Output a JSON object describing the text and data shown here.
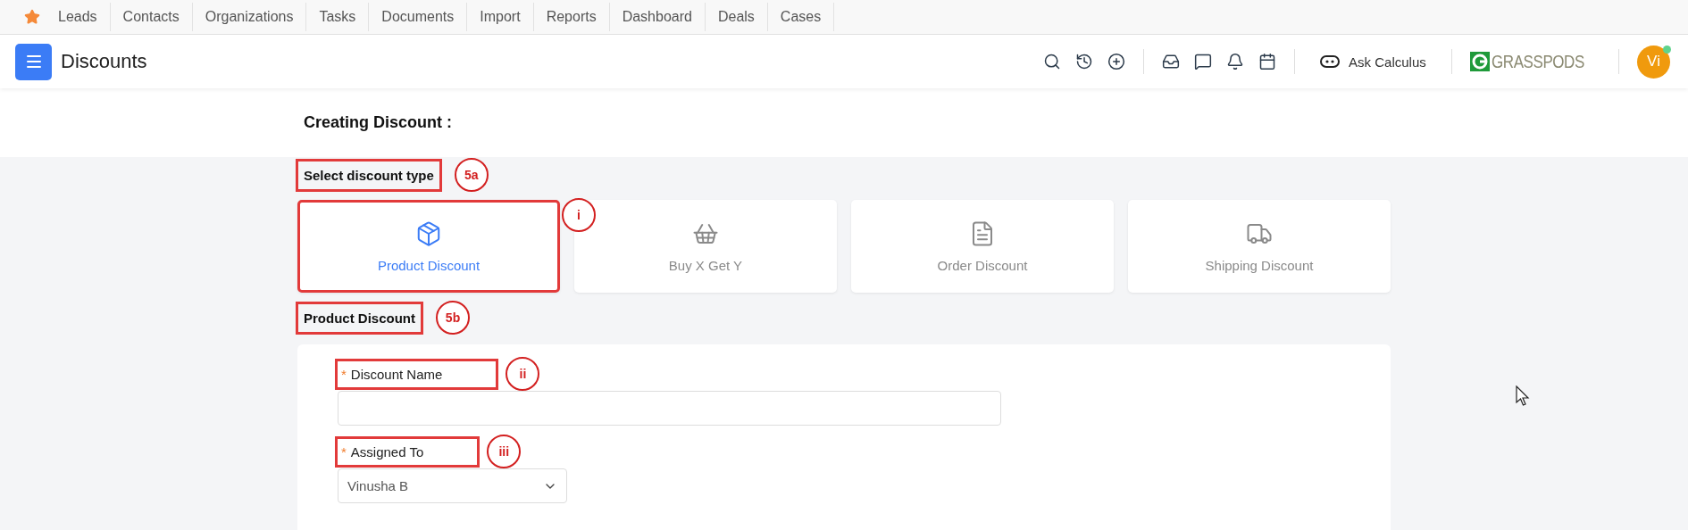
{
  "top_nav": {
    "items": [
      {
        "label": "Leads"
      },
      {
        "label": "Contacts"
      },
      {
        "label": "Organizations"
      },
      {
        "label": "Tasks"
      },
      {
        "label": "Documents"
      },
      {
        "label": "Import"
      },
      {
        "label": "Reports"
      },
      {
        "label": "Dashboard"
      },
      {
        "label": "Deals"
      },
      {
        "label": "Cases"
      }
    ]
  },
  "header": {
    "title": "Discounts",
    "ask_label": "Ask Calculus",
    "logo_text": "GRASSPODS",
    "avatar": {
      "initials": "Vi",
      "online": true
    }
  },
  "page": {
    "heading": "Creating Discount :"
  },
  "type_section": {
    "label": "Select discount type",
    "callout": "5a"
  },
  "discount_types": [
    {
      "label": "Product Discount",
      "kind": "product",
      "selected": true,
      "callout": "i"
    },
    {
      "label": "Buy X Get Y",
      "kind": "bogo",
      "selected": false
    },
    {
      "label": "Order Discount",
      "kind": "order",
      "selected": false
    },
    {
      "label": "Shipping Discount",
      "kind": "shipping",
      "selected": false
    }
  ],
  "form_section": {
    "label": "Product Discount",
    "callout": "5b"
  },
  "fields": [
    {
      "label": "Discount Name",
      "kind": "text",
      "required_mark": "*",
      "callout": "ii"
    },
    {
      "label": "Assigned To",
      "kind": "select",
      "required_mark": "*",
      "value": "Vinusha B",
      "callout": "iii"
    }
  ]
}
